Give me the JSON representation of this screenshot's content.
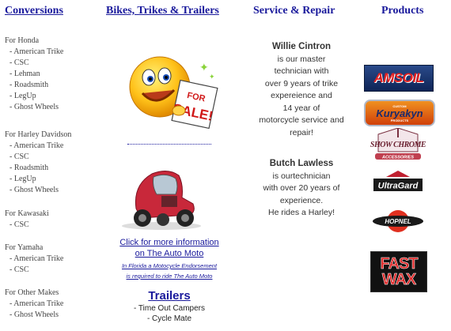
{
  "headers": {
    "conversions": "Conversions",
    "bikes": "Bikes, Trikes & Trailers",
    "service": "Service & Repair",
    "products": "Products"
  },
  "conversions": [
    {
      "make": "For Honda",
      "items": [
        "- American Trike",
        "- CSC",
        "- Lehman",
        "- Roadsmith",
        "- LegUp",
        "- Ghost Wheels"
      ]
    },
    {
      "make": "For Harley Davidson",
      "items": [
        "- American Trike",
        "- CSC",
        "- Roadsmith",
        "- LegUp",
        "- Ghost Wheels"
      ]
    },
    {
      "make": "For Kawasaki",
      "items": [
        "- CSC"
      ]
    },
    {
      "make": "For Yamaha",
      "items": [
        "- American Trike",
        "- CSC"
      ]
    },
    {
      "make": "For Other Makes",
      "items": [
        "- American Trike",
        "- Ghost Wheels"
      ]
    }
  ],
  "for_sale": {
    "line1": "FOR",
    "line2": "SALE!"
  },
  "auto_moto": {
    "link1": "Click for more information",
    "link2": "on The Auto Moto",
    "note1": "In Florida a Motocycle Endorsement",
    "note2": "is required to ride The Auto Moto"
  },
  "trailers": {
    "heading": "Trailers",
    "items": [
      "- Time Out Campers",
      "- Cycle Mate"
    ]
  },
  "techs": [
    {
      "name": "Willie Cintron",
      "lines": [
        "is our master",
        "technician with",
        "over 9 years of trike",
        "expereience and",
        "14 year of",
        "motorcycle service and",
        "repair!"
      ]
    },
    {
      "name": "Butch Lawless",
      "lines": [
        "is ourtechnician",
        "with over 20 years of",
        "experience.",
        "He rides a Harley!"
      ]
    }
  ],
  "products": {
    "amsoil": "AMSOIL",
    "kuryakyn": "Kuryakyn",
    "kuryakyn_sub": "PRODUCTS",
    "kuryakyn_top": "CUSTOM",
    "showchrome": "SHOW CHROME",
    "showchrome_sub": "ACCESSORIES",
    "ultragard": "UltraGard",
    "hopnel": "HOPNEL",
    "fastwax1": "FAST",
    "fastwax2": "WAX"
  },
  "colors": {
    "link": "#1a1a9c",
    "amsoil_red": "#d01818",
    "fastwax_red": "#c82020"
  }
}
